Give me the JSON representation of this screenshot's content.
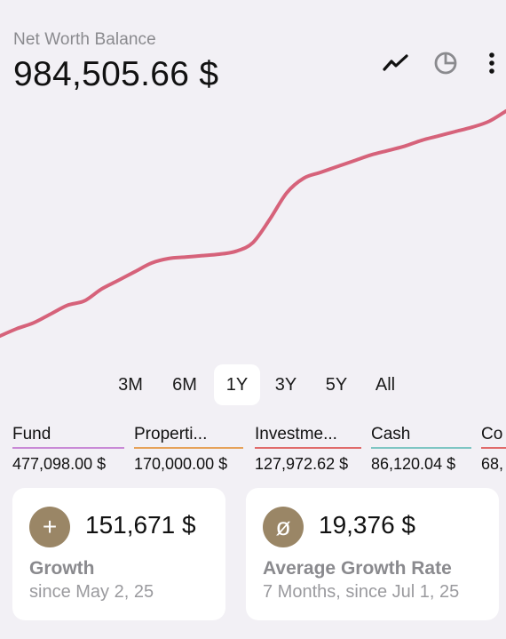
{
  "header": {
    "subtitle": "Net Worth Balance",
    "balance": "984,505.66 $"
  },
  "toolbar": {
    "icons": [
      "line-chart-icon",
      "pie-chart-icon",
      "more-vertical-icon"
    ]
  },
  "ranges": {
    "items": [
      "3M",
      "6M",
      "1Y",
      "3Y",
      "5Y",
      "All"
    ],
    "selected": "1Y"
  },
  "categories": [
    {
      "name": "Fund",
      "value": "477,098.00 $",
      "color": "#c98ad6"
    },
    {
      "name": "Properti...",
      "value": "170,000.00 $",
      "color": "#e6a25a"
    },
    {
      "name": "Investme...",
      "value": "127,972.62 $",
      "color": "#e06b6b"
    },
    {
      "name": "Cash",
      "value": "86,120.04 $",
      "color": "#7fc6c4"
    },
    {
      "name": "Co",
      "value": "68,",
      "color": "#e06b6b"
    }
  ],
  "cards": {
    "growth": {
      "badge": "+",
      "amount": "151,671 $",
      "title": "Growth",
      "sub": "since May 2, 25"
    },
    "rate": {
      "badge": "ø",
      "amount": "19,376 $",
      "title": "Average Growth Rate",
      "sub": "7 Months, since Jul 1, 25"
    }
  },
  "colors": {
    "line": "#d6627a",
    "badge": "#9a8666",
    "background": "#f2f0f5"
  },
  "chart_data": {
    "type": "line",
    "title": "",
    "xlabel": "",
    "ylabel": "",
    "x": [
      0,
      1,
      2,
      3,
      4,
      5,
      6,
      7,
      8,
      9,
      10,
      11,
      12,
      13,
      14,
      15,
      16,
      17,
      18,
      19,
      20,
      21,
      22,
      23,
      24,
      25,
      26,
      27,
      28,
      29,
      30
    ],
    "series": [
      {
        "values": [
          0.0,
          0.05,
          0.09,
          0.15,
          0.21,
          0.24,
          0.32,
          0.38,
          0.44,
          0.5,
          0.53,
          0.54,
          0.55,
          0.56,
          0.58,
          0.64,
          0.8,
          0.98,
          1.08,
          1.12,
          1.16,
          1.2,
          1.24,
          1.27,
          1.3,
          1.34,
          1.37,
          1.4,
          1.43,
          1.47,
          1.54
        ]
      }
    ]
  }
}
